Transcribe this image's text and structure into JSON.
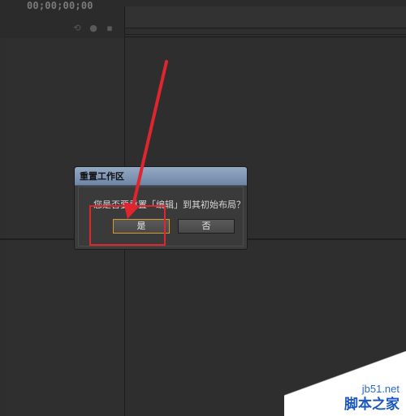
{
  "timecode": "00;00;00;00",
  "dialog": {
    "title": "重置工作区",
    "message": "您是否要重置「编辑」到其初始布局？",
    "yes_label": "是",
    "no_label": "否"
  },
  "watermark": {
    "site": "jb51.net",
    "name": "脚本之家"
  },
  "colors": {
    "accent_red": "#e0252f",
    "default_button_border": "#d89a2a"
  }
}
